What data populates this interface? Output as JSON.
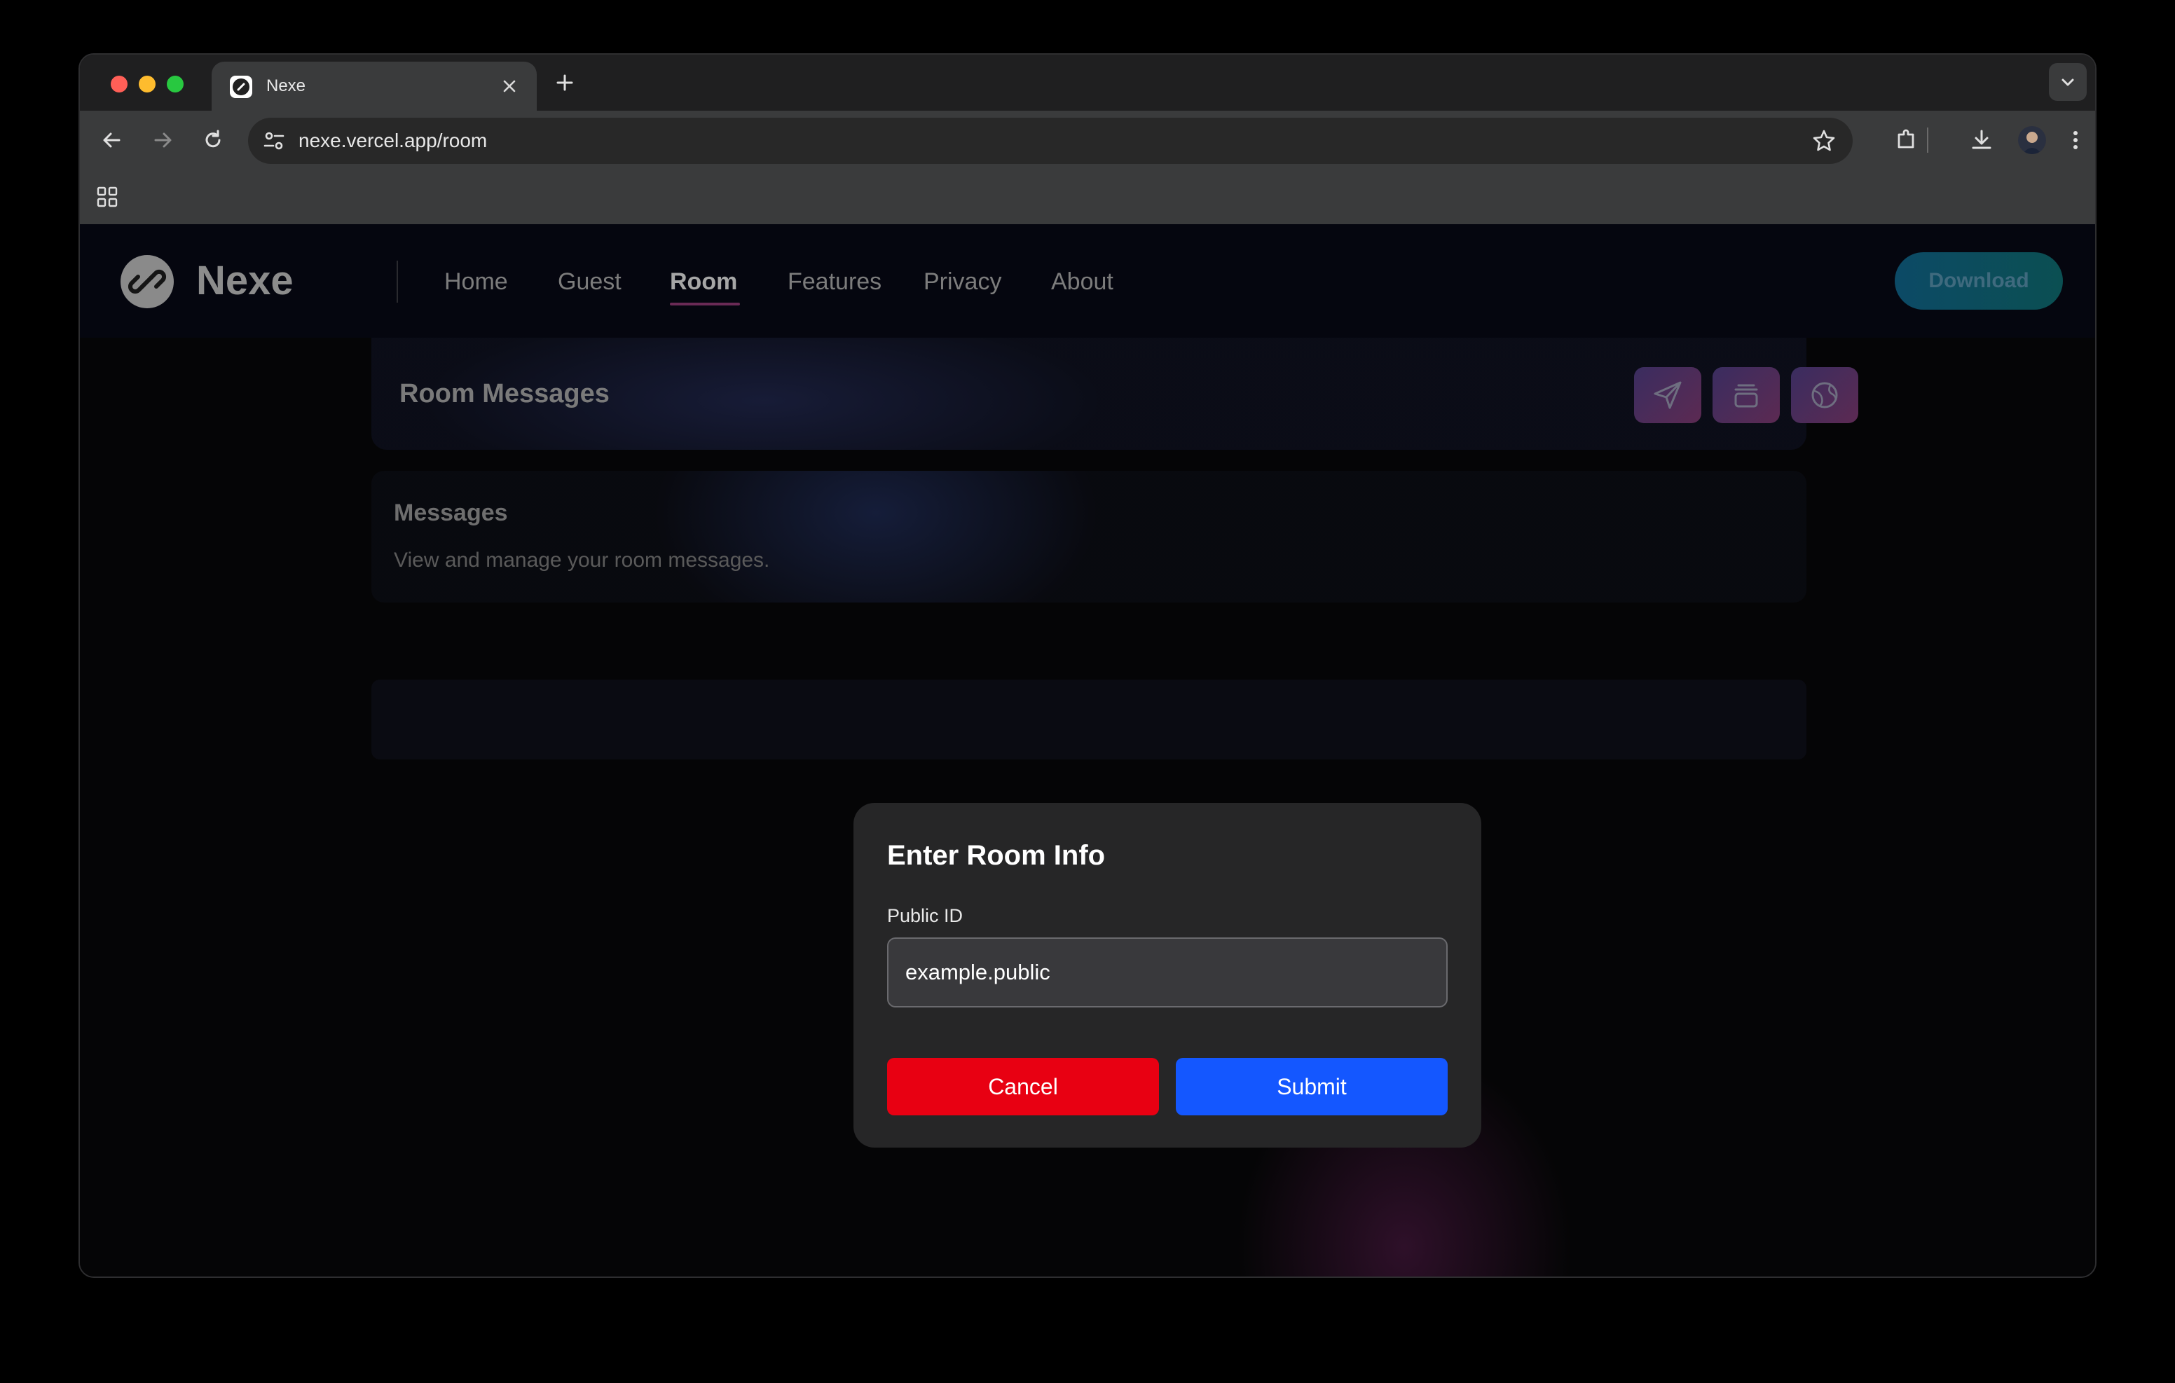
{
  "browser": {
    "tab": {
      "title": "Nexe"
    },
    "address_bar": {
      "url": "nexe.vercel.app/room"
    }
  },
  "navbar": {
    "logo_text": "Nexe",
    "links": [
      {
        "label": "Home"
      },
      {
        "label": "Guest"
      },
      {
        "label": "Room"
      },
      {
        "label": "Features"
      },
      {
        "label": "Privacy"
      },
      {
        "label": "About"
      }
    ],
    "download_label": "Download"
  },
  "room_header": {
    "title": "Room Messages",
    "actions": [
      "send-icon",
      "layers-icon",
      "globe-icon"
    ]
  },
  "messages_card": {
    "title": "Messages",
    "subtitle": "View and manage your room messages."
  },
  "dialog": {
    "title": "Enter Room Info",
    "field_label": "Public ID",
    "field_value": "example.public",
    "cancel_label": "Cancel",
    "submit_label": "Submit"
  },
  "colors": {
    "cancel": "#e80012",
    "submit": "#1457ff",
    "dialog_bg": "#262627"
  }
}
